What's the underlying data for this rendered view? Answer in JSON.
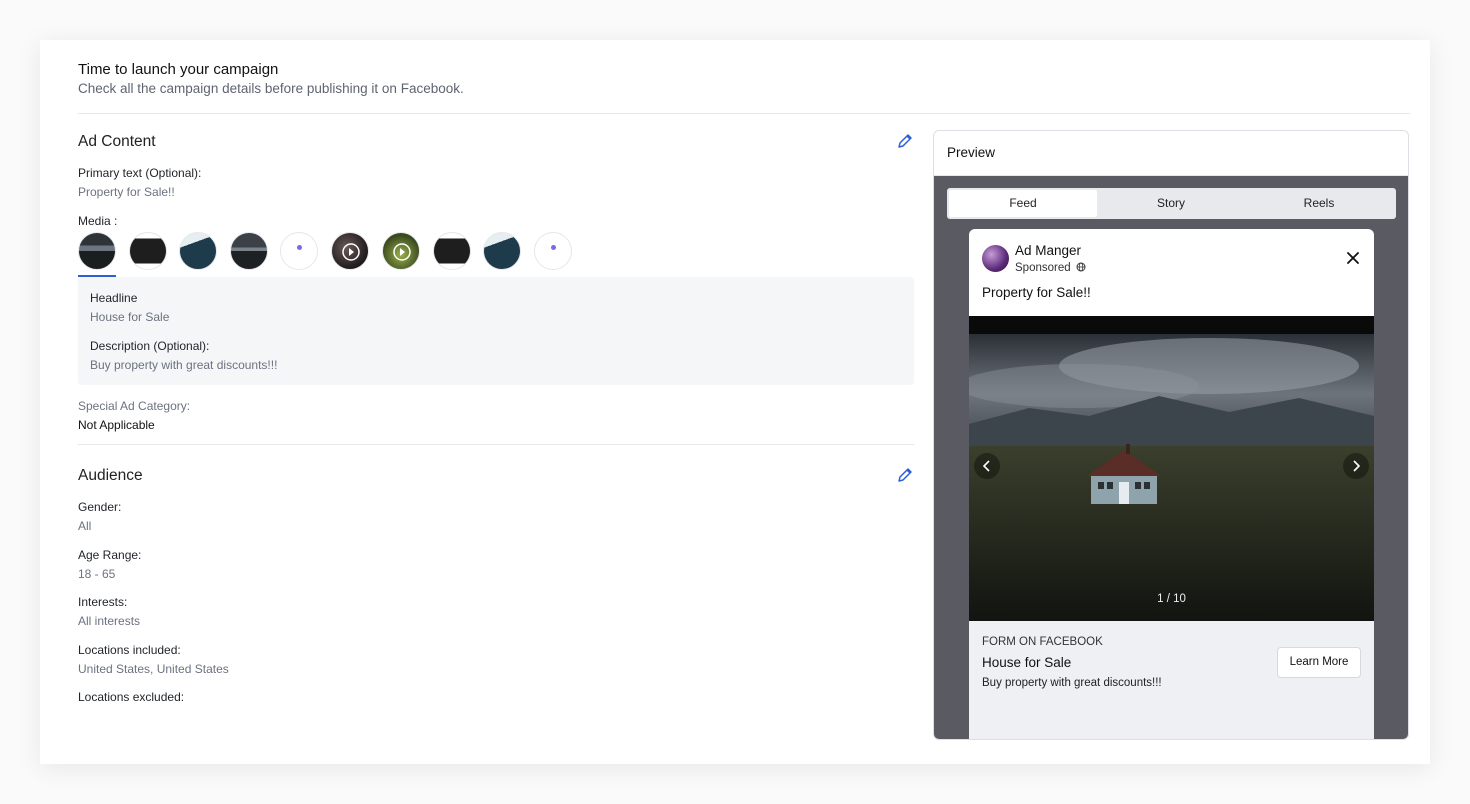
{
  "header": {
    "title": "Time to launch your campaign",
    "subtitle": "Check all the campaign details before publishing it on Facebook."
  },
  "ad_content": {
    "title": "Ad Content",
    "primary_text_label": "Primary text (Optional):",
    "primary_text_value": "Property for Sale!!",
    "media_label": "Media :",
    "headline_label": "Headline",
    "headline_value": "House for Sale",
    "description_label": "Description (Optional):",
    "description_value": "Buy property with great discounts!!!",
    "special_category_label": "Special Ad Category:",
    "special_category_value": "Not Applicable"
  },
  "audience": {
    "title": "Audience",
    "gender_label": "Gender:",
    "gender_value": "All",
    "age_label": "Age Range:",
    "age_value": "18 - 65",
    "interests_label": "Interests:",
    "interests_value": "All interests",
    "loc_incl_label": "Locations included:",
    "loc_incl_value": "United States, United States",
    "loc_excl_label": "Locations excluded:"
  },
  "preview": {
    "title": "Preview",
    "tabs": [
      "Feed",
      "Story",
      "Reels"
    ],
    "account_name": "Ad Manger",
    "sponsored": "Sponsored",
    "post_text": "Property for Sale!!",
    "counter": "1 / 10",
    "cta_caption": "FORM ON FACEBOOK",
    "cta_headline": "House for Sale",
    "cta_description": "Buy property with great discounts!!!",
    "cta_button": "Learn More"
  },
  "colors": {
    "accent": "#2c5fd6",
    "muted_text": "#6b7280",
    "preview_bg": "#5a5b62"
  }
}
